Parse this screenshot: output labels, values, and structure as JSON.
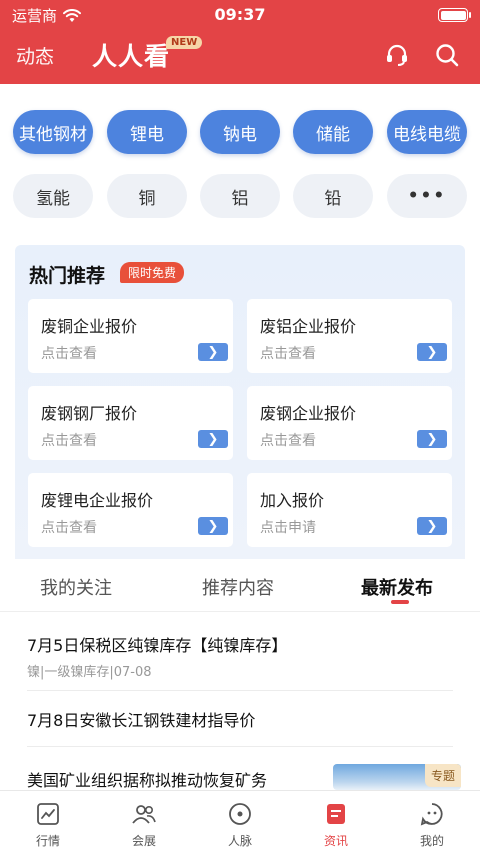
{
  "status_bar": {
    "carrier": "运营商",
    "time": "09:37"
  },
  "header": {
    "left_tab": "动态",
    "brand": "人人看",
    "badge": "NEW",
    "icons": [
      "headset-icon",
      "search-icon"
    ]
  },
  "categories": {
    "row1": [
      "其他钢材",
      "锂电",
      "钠电",
      "储能",
      "电线电缆"
    ],
    "row2": [
      "氢能",
      "铜",
      "铝",
      "铅",
      "•••"
    ]
  },
  "hot": {
    "title": "热门推荐",
    "badge": "限时免费",
    "cards": [
      {
        "title": "废铜企业报价",
        "sub": "点击查看"
      },
      {
        "title": "废铝企业报价",
        "sub": "点击查看"
      },
      {
        "title": "废钢钢厂报价",
        "sub": "点击查看"
      },
      {
        "title": "废钢企业报价",
        "sub": "点击查看"
      },
      {
        "title": "废锂电企业报价",
        "sub": "点击查看"
      },
      {
        "title": "加入报价",
        "sub": "点击申请"
      }
    ]
  },
  "tabs": [
    "我的关注",
    "推荐内容",
    "最新发布"
  ],
  "news": [
    {
      "title": "7月5日保税区纯镍库存【纯镍库存】",
      "meta": "镍|一级镍库存|07-08"
    },
    {
      "title": "7月8日安徽长江钢铁建材指导价"
    },
    {
      "title": "美国矿业组织据称拟推动恢复矿务",
      "tag": "专题"
    }
  ],
  "bottom_nav": [
    {
      "label": "行情",
      "icon": "chart-icon"
    },
    {
      "label": "会展",
      "icon": "people-icon"
    },
    {
      "label": "人脉",
      "icon": "compass-icon"
    },
    {
      "label": "资讯",
      "icon": "news-icon",
      "active": true
    },
    {
      "label": "我的",
      "icon": "profile-icon"
    }
  ],
  "colors": {
    "brand_red": "#e34446",
    "chip_blue": "#4d83de",
    "arrow_blue": "#5a8fe0"
  }
}
